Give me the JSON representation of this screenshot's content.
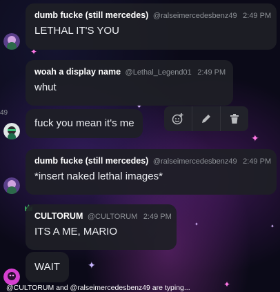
{
  "messages": [
    {
      "author": "dumb fucke (still mercedes)",
      "handle": "@ralseimercedesbenz49",
      "time": "2:49 PM",
      "text": "LETHAL IT'S YOU"
    },
    {
      "author": "woah a display name",
      "handle": "@Lethal_Legend01",
      "time": "2:49 PM",
      "text": "whut"
    },
    {
      "text": "fuck you mean it's me"
    },
    {
      "author": "dumb fucke (still mercedes)",
      "handle": "@ralseimercedesbenz49",
      "time": "2:49 PM",
      "text": "*insert naked lethal images*"
    },
    {
      "author": "CULTORUM",
      "handle": "@CULTORUM",
      "time": "2:49 PM",
      "text": "ITS A ME, MARIO"
    },
    {
      "text": "WAIT"
    }
  ],
  "edge_timestamp": "49",
  "toolbar": {
    "icons": [
      "add-reaction-icon",
      "pencil-icon",
      "trash-icon"
    ]
  },
  "typing_indicator": "@CULTORUM and @ralseimercedesbenz49 are typing...",
  "colors": {
    "bubble": "#1e1f26",
    "muted": "#8e9297",
    "crown": "#3ba55c",
    "star": "#e070ff"
  }
}
